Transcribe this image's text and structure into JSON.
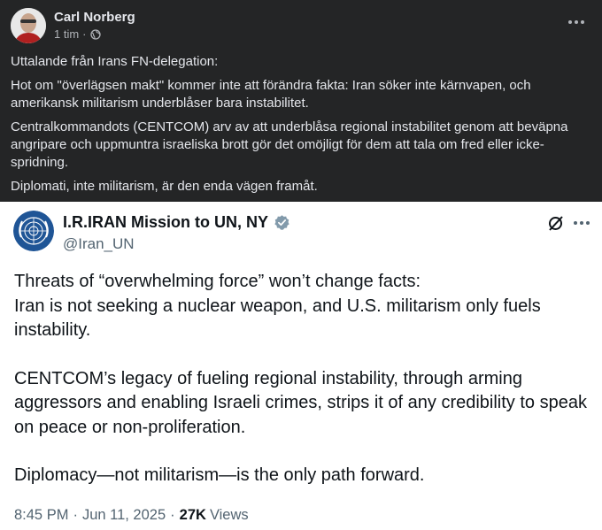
{
  "facebook_post": {
    "author": "Carl Norberg",
    "time": "1 tim",
    "separator": "·",
    "paragraphs": [
      "Uttalande från Irans FN-delegation:",
      "Hot om \"överlägsen makt\" kommer inte att förändra fakta: Iran söker inte kärnvapen, och amerikansk militarism underblåser bara instabilitet.",
      "Centralkommandots (CENTCOM) arv av att underblåsa regional instabilitet genom att beväpna angripare och uppmuntra israeliska brott gör det omöjligt för dem att tala om fred eller icke-spridning.",
      "Diplomati, inte militarism, är den enda vägen framåt."
    ]
  },
  "tweet": {
    "display_name": "I.R.IRAN Mission to UN, NY",
    "handle": "@Iran_UN",
    "paragraphs": [
      "Threats of “overwhelming force” won’t change facts:\nIran is not seeking a nuclear weapon, and U.S. militarism only fuels instability.",
      "CENTCOM’s legacy of fueling regional instability, through arming aggressors and enabling Israeli crimes, strips it of any credibility to speak on peace or non-proliferation.",
      "Diplomacy—not militarism—is the only path forward."
    ],
    "time": "8:45 PM",
    "date": "Jun 11, 2025",
    "separator": "·",
    "views_count": "27K",
    "views_label": "Views"
  },
  "colors": {
    "fb_background": "#242526",
    "fb_text": "#e4e6eb",
    "fb_secondary": "#b0b3b8",
    "tweet_background": "#ffffff",
    "tweet_text": "#0f1419",
    "tweet_secondary": "#536471",
    "verified_badge": "#829aab",
    "un_emblem_blue": "#1f5596"
  },
  "icons": {
    "privacy": "globe-icon",
    "fb_menu": "more-options-icon",
    "verified": "verified-badge-icon",
    "grok": "grok-icon",
    "tweet_menu": "more-options-icon"
  }
}
